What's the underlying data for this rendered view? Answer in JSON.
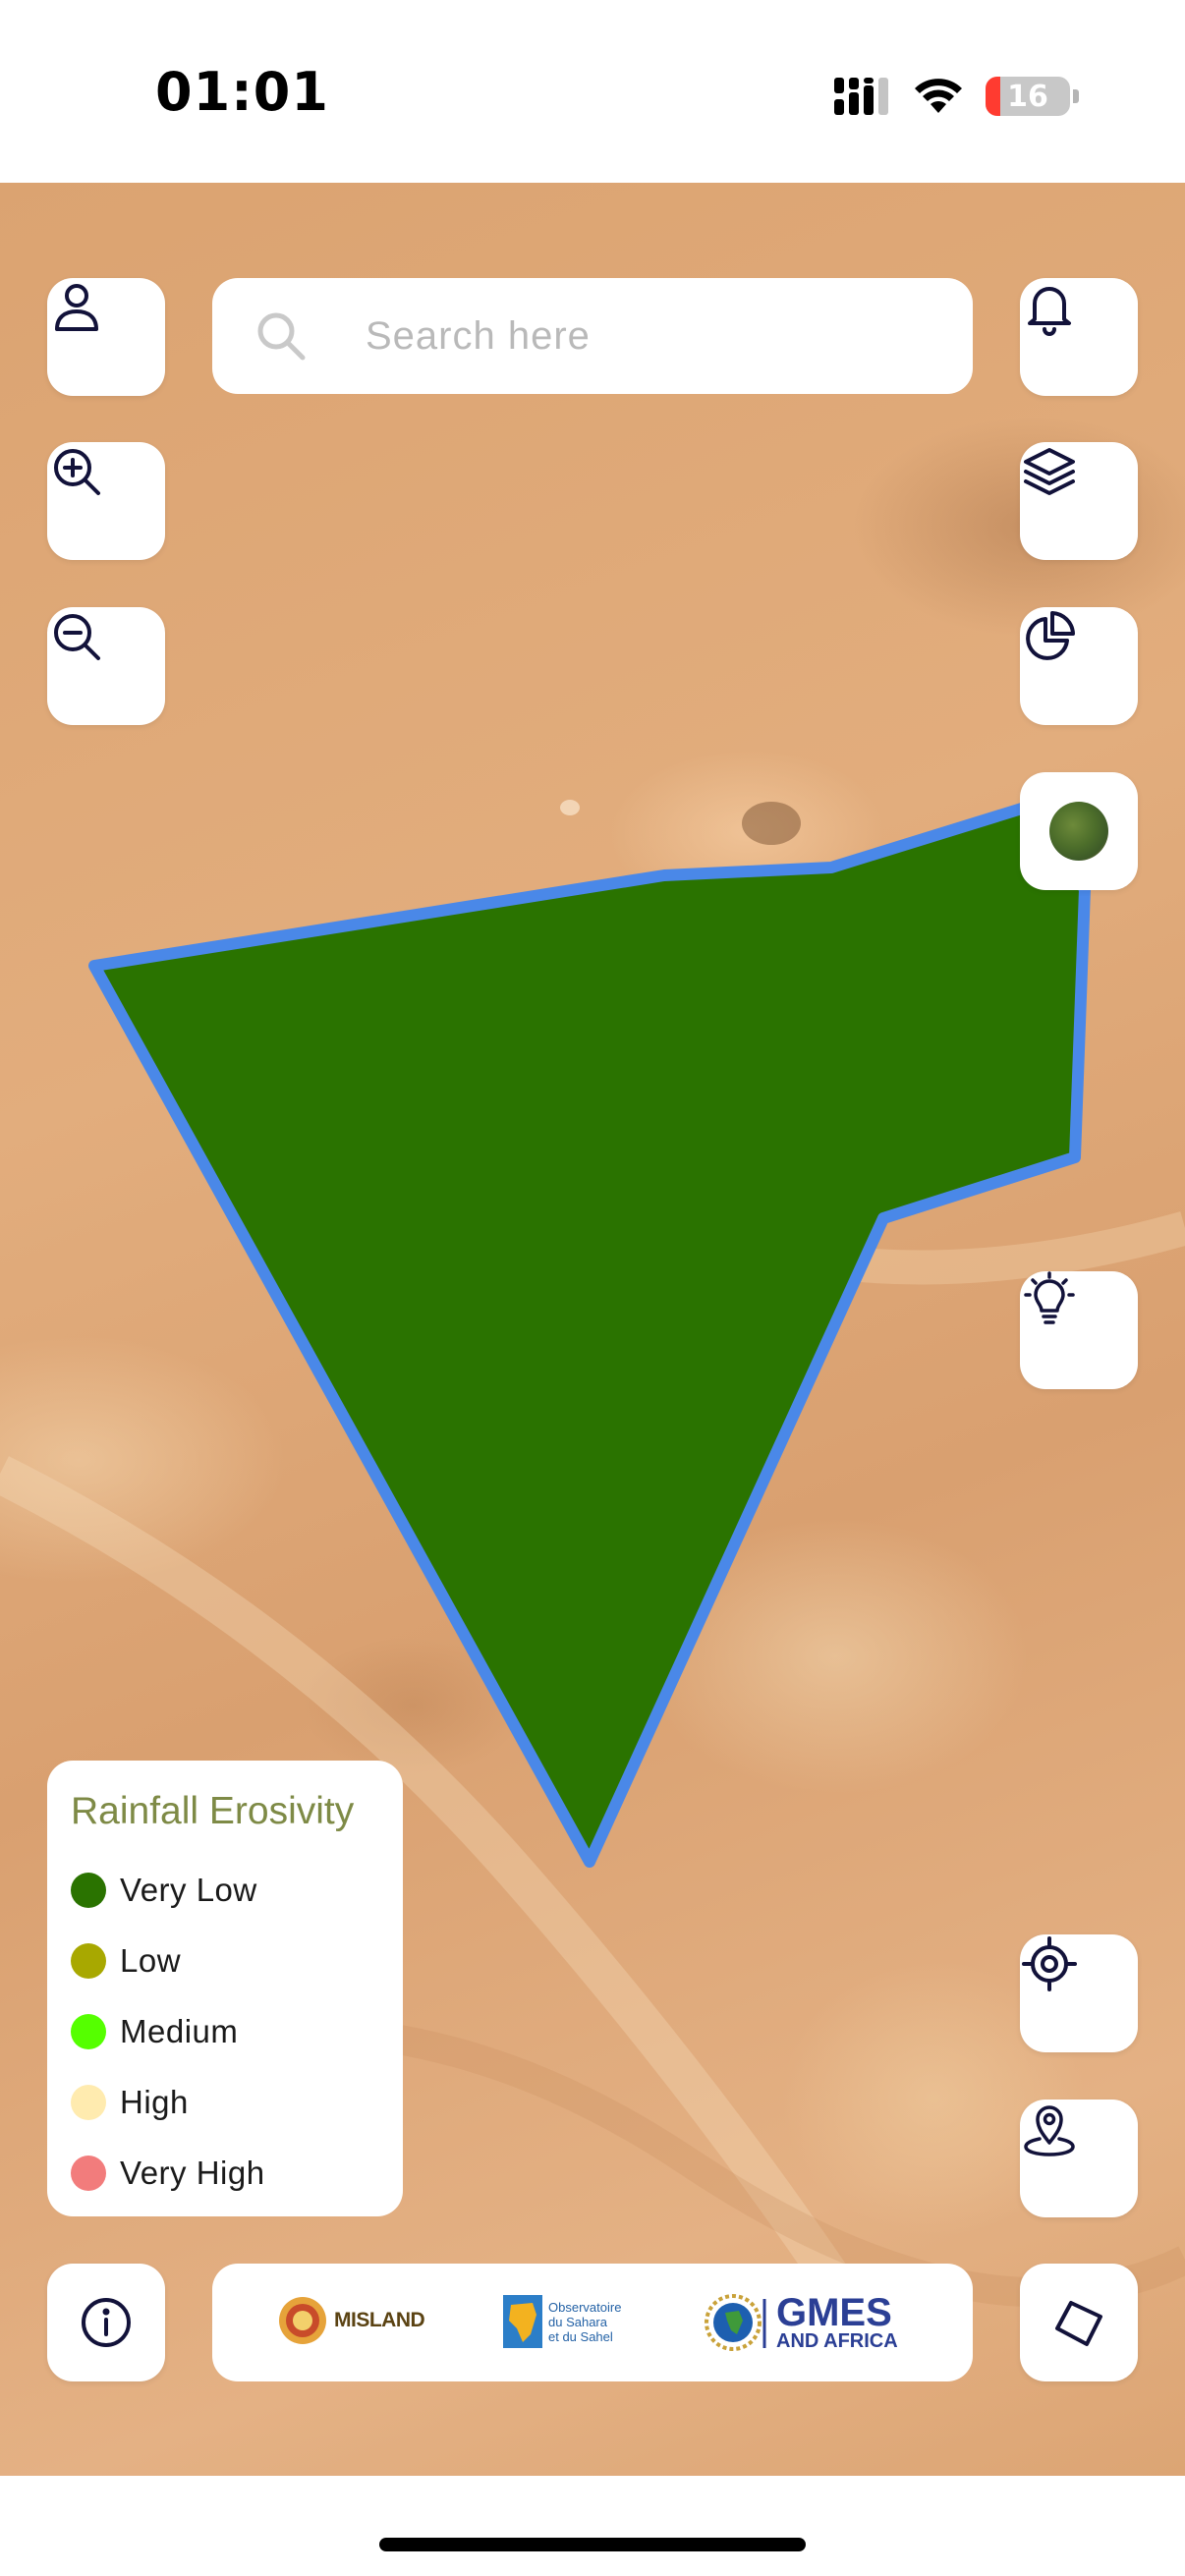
{
  "status_bar": {
    "time": "01:01",
    "battery_level": "16",
    "signal_icon": "cellular-signal-icon",
    "wifi_icon": "wifi-icon"
  },
  "search": {
    "placeholder": "Search here",
    "value": ""
  },
  "buttons": {
    "profile": "user-icon",
    "zoom_in": "zoom-in-icon",
    "zoom_out": "zoom-out-icon",
    "notifications": "bell-icon",
    "layers": "layers-icon",
    "statistics": "pie-chart-icon",
    "basemap": "satellite-basemap-thumbnail",
    "tips": "lightbulb-icon",
    "locate": "crosshair-icon",
    "pin": "map-pin-icon",
    "info": "info-icon",
    "draw": "polygon-icon"
  },
  "legend": {
    "title": "Rainfall Erosivity",
    "items": [
      {
        "label": "Very Low",
        "color": "#2a7300"
      },
      {
        "label": "Low",
        "color": "#a8a800"
      },
      {
        "label": "Medium",
        "color": "#55ff00"
      },
      {
        "label": "High",
        "color": "#ffebaf"
      },
      {
        "label": "Very High",
        "color": "#f27c7c"
      }
    ]
  },
  "map": {
    "fill_color": "#2a7300",
    "outline_color": "#4a88e8",
    "base_color": "#dba371"
  },
  "logos": {
    "misland": "MISLAND",
    "oss_line1": "Observatoire",
    "oss_line2": "du Sahara",
    "oss_line3": "et du Sahel",
    "gmes_main": "GMES",
    "gmes_sub": "AND AFRICA"
  }
}
